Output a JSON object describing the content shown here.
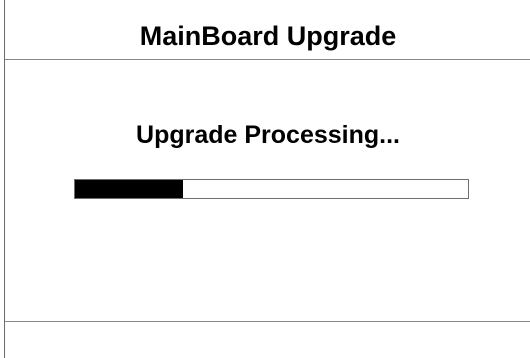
{
  "window": {
    "title": "MainBoard Upgrade"
  },
  "upgrade": {
    "status_text": "Upgrade Processing...",
    "progress_fraction": 0.275
  },
  "colors": {
    "progress_fill": "#000000",
    "background": "#ffffff"
  }
}
